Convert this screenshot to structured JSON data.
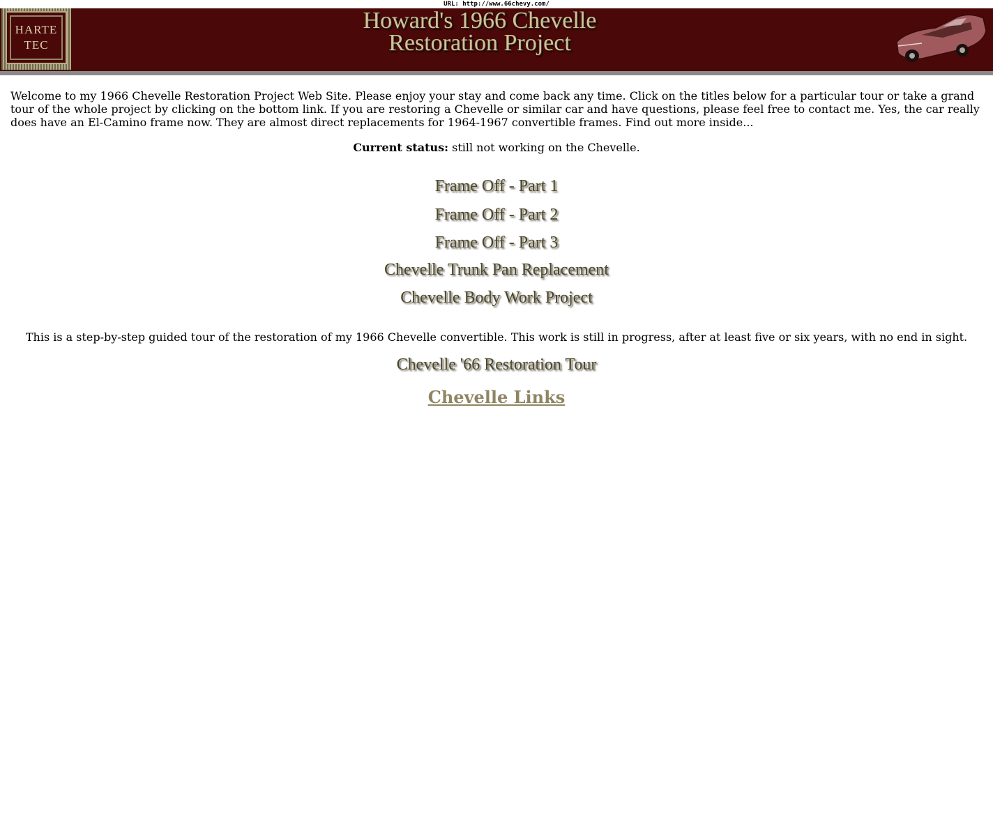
{
  "url_bar": "URL: http://www.66chevy.com/",
  "banner": {
    "logo_line1": "HARTE",
    "logo_line2": "TEC",
    "title_line1": "Howard's 1966 Chevelle",
    "title_line2": "Restoration Project",
    "car_image": "car-image-icon",
    "background_color": "#4a0808"
  },
  "intro": "Welcome to my 1966 Chevelle Restoration Project Web Site.  Please enjoy your stay and  come back any time.  Click on the titles below for a particular tour or take a grand tour of the whole project by clicking on the bottom link. If you are restoring a Chevelle or similar car and have questions, please feel free to contact me.  Yes, the car really does have an El-Camino frame now.  They are almost direct replacements for 1964-1967 convertible frames.  Find out more inside...",
  "status": {
    "label": "Current status:",
    "value": " still not working on the Chevelle."
  },
  "tours": [
    "Frame Off - Part 1",
    "Frame Off - Part 2",
    "Frame Off - Part 3",
    "Chevelle Trunk Pan Replacement",
    "Chevelle Body Work Project"
  ],
  "guided_text": "This is a step-by-step guided tour of the restoration of my 1966 Chevelle convertible.  This work is still in progress, after at least five or six years, with no end in sight.",
  "grand_tour": "Chevelle '66 Restoration Tour",
  "chevelle_links": "Chevelle Links",
  "colors": {
    "link_text": "#8f8563",
    "title_text": "#cdc39a"
  }
}
